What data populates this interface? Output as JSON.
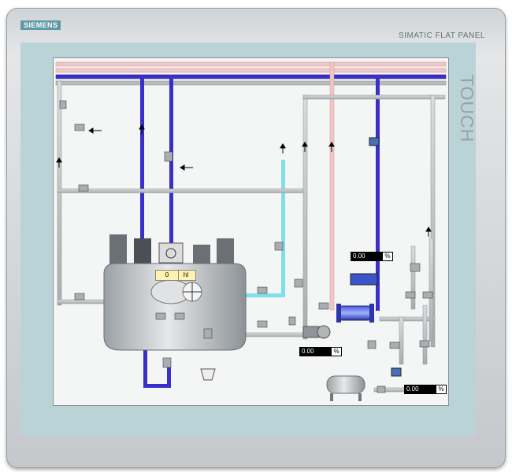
{
  "device": {
    "brand": "SIEMENS",
    "model": "SIMATIC FLAT PANEL",
    "touch_label": "TOUCH"
  },
  "tank": {
    "level_value": "0",
    "level_unit": "hl"
  },
  "readouts": [
    {
      "value": "0.00",
      "unit": "%"
    },
    {
      "value": "0.00",
      "unit": "%"
    },
    {
      "value": "0.00",
      "unit": "%"
    }
  ],
  "colors": {
    "frame": "#b9d3d6",
    "screen_bg": "#f4f5f5",
    "pipe_blue": "#3b2fc9",
    "pipe_cyan": "#7fe0ec",
    "pipe_pink": "#f2c6c6",
    "pipe_grey": "#b8bcbf",
    "valve_green": "#3a8a3a",
    "pump_blue": "#4a6fb5"
  }
}
